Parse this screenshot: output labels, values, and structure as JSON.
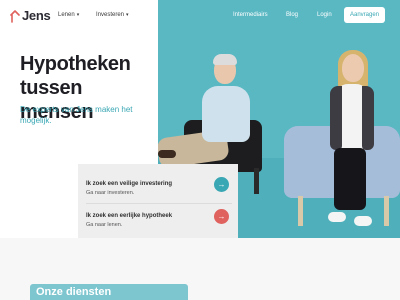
{
  "nav": {
    "logo_text": "Jens",
    "items": [
      {
        "label": "Lenen",
        "chevron": "▾"
      },
      {
        "label": "Investeren",
        "chevron": "▾"
      }
    ],
    "right_links": [
      "Intermediairs",
      "Blog",
      "Login"
    ],
    "cta_label": "Aanvragen"
  },
  "hero": {
    "title": "Hypotheken tussen mensen",
    "subtitle": "De experts van Jens maken het mogelijk."
  },
  "cards": [
    {
      "title": "Ik zoek een veilige investering",
      "subtitle": "Ga naar investeren.",
      "arrow": "→",
      "color": "#3aa7b4"
    },
    {
      "title": "Ik zoek een eerlijke hypotheek",
      "subtitle": "Ga naar lenen.",
      "arrow": "→",
      "color": "#e0625e"
    }
  ],
  "services": {
    "title": "Onze diensten"
  },
  "colors": {
    "teal": "#5ab8c3",
    "accent": "#3aa7b4",
    "coral": "#e0625e"
  }
}
